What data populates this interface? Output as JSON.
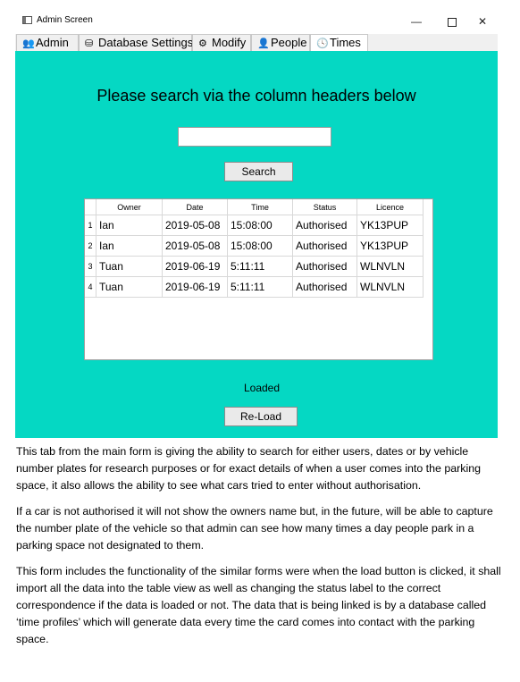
{
  "window": {
    "title": "Admin Screen",
    "minimize": "—",
    "maximize": "",
    "close": "✕"
  },
  "tabs": [
    {
      "label": "Admin",
      "icon": "admin-icon",
      "glyph": "👥"
    },
    {
      "label": "Database Settings",
      "icon": "database-icon",
      "glyph": "⛁"
    },
    {
      "label": "Modify",
      "icon": "gear-icon",
      "glyph": "⚙"
    },
    {
      "label": "People",
      "icon": "person-icon",
      "glyph": "👤"
    },
    {
      "label": "Times",
      "icon": "clock-icon",
      "glyph": "🕓"
    }
  ],
  "active_tab": "Times",
  "main": {
    "heading": "Please search via the column headers below",
    "search": {
      "value": "",
      "placeholder": ""
    },
    "search_button": "Search",
    "status_label": "Loaded",
    "reload_button": "Re-Load",
    "background": "#05d8c3"
  },
  "table": {
    "columns": [
      "Owner",
      "Date",
      "Time",
      "Status",
      "Licence"
    ],
    "rows": [
      {
        "num": "1",
        "cells": [
          "Ian",
          "2019-05-08",
          "15:08:00",
          "Authorised",
          "YK13PUP"
        ]
      },
      {
        "num": "2",
        "cells": [
          "Ian",
          "2019-05-08",
          "15:08:00",
          "Authorised",
          "YK13PUP"
        ]
      },
      {
        "num": "3",
        "cells": [
          "Tuan",
          "2019-06-19",
          "5:11:11",
          "Authorised",
          "WLNVLN"
        ]
      },
      {
        "num": "4",
        "cells": [
          "Tuan",
          "2019-06-19",
          "5:11:11",
          "Authorised",
          "WLNVLN"
        ]
      }
    ]
  },
  "document": {
    "paragraphs": [
      "This tab from the main form is giving the ability to search for either users, dates or by vehicle number plates for research purposes or for exact details of when a user comes into the parking space, it also allows the ability to see what cars tried to enter without authorisation.",
      "If a car is not authorised it will not show the owners name but, in the future, will be able to capture the number plate of the vehicle so that admin can see how many times a day people park in a parking space not designated to them.",
      "This form includes the functionality of the similar forms were when the load button is clicked, it shall import all the data into the table view as well as changing the status label to the correct correspondence if the data is loaded or not. The data that is being linked is by a database called ‘time profiles’ which will generate data every time the card comes into contact with the parking space."
    ]
  }
}
